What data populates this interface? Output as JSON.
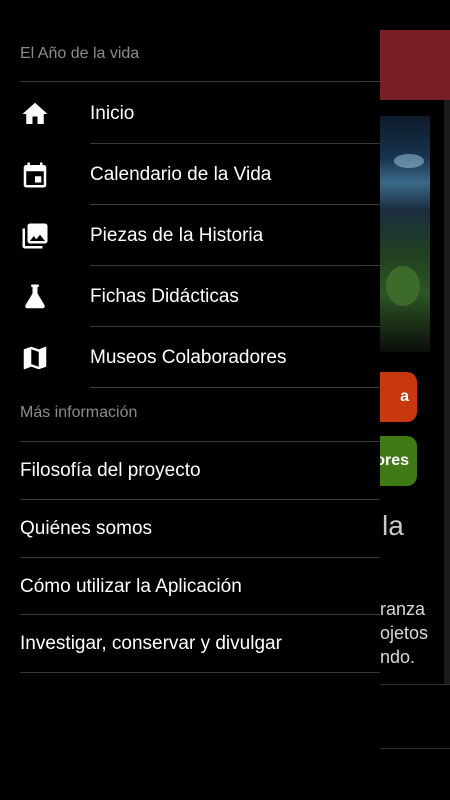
{
  "app": {
    "drawer_title": "El Año de la vida"
  },
  "nav": {
    "items": [
      {
        "label": "Inicio",
        "icon": "home-icon"
      },
      {
        "label": "Calendario de la Vida",
        "icon": "calendar-icon"
      },
      {
        "label": "Piezas de la Historia",
        "icon": "photos-icon"
      },
      {
        "label": "Fichas Didácticas",
        "icon": "flask-icon"
      },
      {
        "label": "Museos Colaboradores",
        "icon": "map-icon"
      }
    ]
  },
  "more": {
    "header": "Más información",
    "items": [
      {
        "label": "Filosofía del proyecto"
      },
      {
        "label": "Quiénes somos"
      },
      {
        "label": "Cómo utilizar la Aplicación"
      },
      {
        "label": "Investigar, conservar y divulgar"
      }
    ]
  },
  "background": {
    "button_orange_text": "a",
    "button_green_text": "ores",
    "heading_fragment": "la",
    "paragraph_lines": [
      "ranza",
      "ojetos",
      "ndo."
    ]
  },
  "colors": {
    "background": "#000000",
    "text": "#ffffff",
    "muted": "#8c8c8c",
    "divider": "#3a3a3a",
    "topbar": "#7a1f24",
    "orange": "#c8380e",
    "green": "#3f7a16"
  }
}
